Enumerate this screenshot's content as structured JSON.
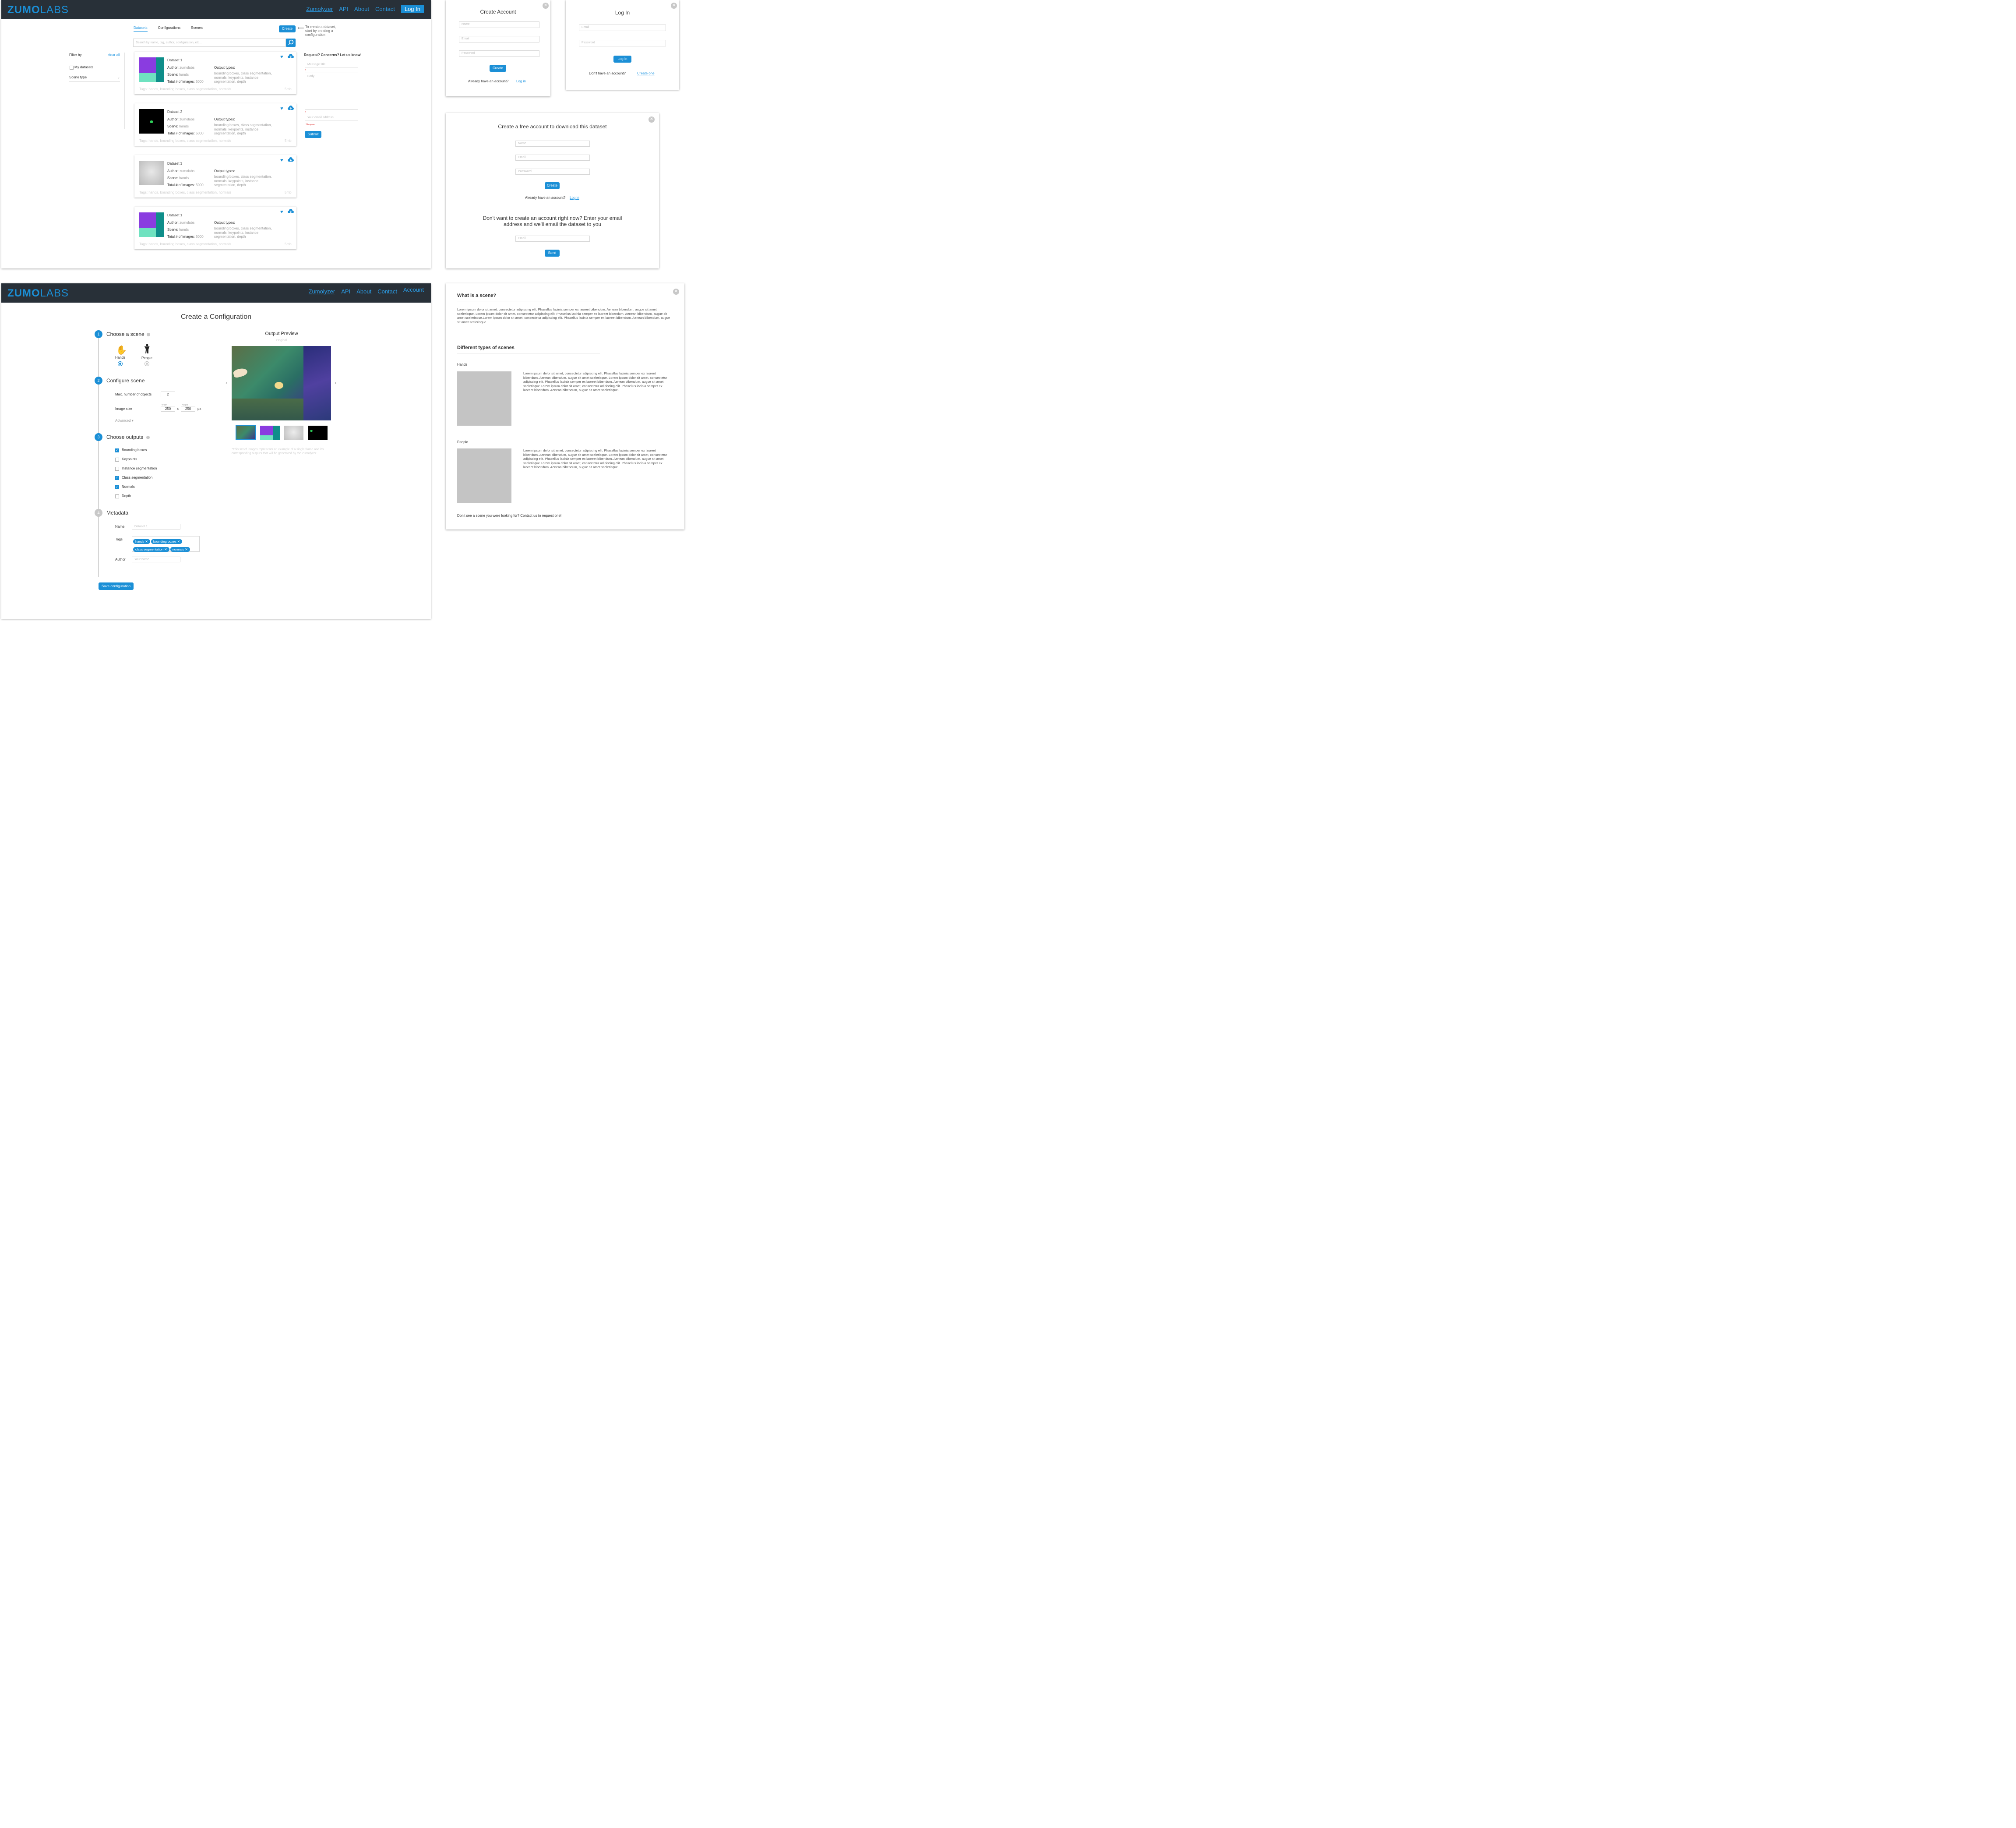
{
  "nav": {
    "logo_a": "ZUMO",
    "logo_b": "LABS",
    "links": [
      "Zumolyzer",
      "API",
      "About",
      "Contact"
    ],
    "login": "Log In",
    "account": "Account"
  },
  "datasets_page": {
    "tabs": [
      "Datasets",
      "Configurations",
      "Scenes"
    ],
    "create": "Create",
    "create_hint": "To create a dataset, start by creating a configuration",
    "search_placeholder": "Search by name, tag, author, configuration, etc...",
    "filter_by": "Filter by",
    "clear_all": "clear all",
    "my_datasets": "My datasets",
    "scene_type": "Scene type",
    "author_label": "Author:",
    "scene_label": "Scene:",
    "total_label": "Total # of images:",
    "output_label": "Output types:",
    "cards": [
      {
        "name": "Dataset 1",
        "author": "zumolabs",
        "scene": "hands",
        "total": "5000",
        "outputs": "bounding boxes, class segmentation, normals, keypoints, instance segmentation, depth",
        "tags": "Tags: hands, bounding boxes, class segmentation, normals",
        "size": "5mb"
      },
      {
        "name": "Dataset 2",
        "author": "zumolabs",
        "scene": "hands",
        "total": "5000",
        "outputs": "bounding boxes, class segmentation, normals, keypoints, instance segmentation, depth",
        "tags": "Tags: hands, bounding boxes, class segmentation, normals",
        "size": "5mb"
      },
      {
        "name": "Dataset 3",
        "author": "zumolabs",
        "scene": "hands",
        "total": "5000",
        "outputs": "bounding boxes, class segmentation, normals, keypoints, instance segmentation, depth",
        "tags": "Tags: hands, bounding boxes, class segmentation, normals",
        "size": "5mb"
      },
      {
        "name": "Dataset 1",
        "author": "zumolabs",
        "scene": "hands",
        "total": "5000",
        "outputs": "bounding boxes, class segmentation, normals, keypoints, instance segmentation, depth",
        "tags": "Tags: hands, bounding boxes, class segmentation, normals",
        "size": "5mb"
      }
    ],
    "request_title": "Request? Concerns? Let us know!",
    "message_title": "Message title",
    "body": "Body",
    "your_email": "Your email address",
    "required": "*Required",
    "submit": "Submit"
  },
  "create_account": {
    "title": "Create Account",
    "name": "Name",
    "email": "Email",
    "password": "Password",
    "button": "Create",
    "already": "Already have an account?",
    "login_link": "Log in"
  },
  "login_modal": {
    "title": "Log In",
    "email": "Email",
    "password": "Password",
    "button": "Log In",
    "no_account": "Don't have an account?",
    "create_link": "Create one"
  },
  "free_account": {
    "title": "Create a free account to download this dataset",
    "name": "Name",
    "email": "Email",
    "password": "Password",
    "button": "Create",
    "already": "Already have an account?",
    "login_link": "Log in",
    "alt_title": "Don't want to create an account right now? Enter your email address and we'll email the dataset to you",
    "alt_email": "Email",
    "send": "Send"
  },
  "config_page": {
    "title": "Create a Configuration",
    "step1": "Choose a scene",
    "hands": "Hands",
    "people": "People",
    "step2": "Configure scene",
    "max_objects": "Max. number of objects",
    "max_objects_val": "2",
    "image_size": "Image size",
    "width_label": "Width",
    "height_label": "Height",
    "width": "250",
    "height": "250",
    "x": "x",
    "px": "px",
    "advanced": "Advanced ▾",
    "step3": "Choose outputs",
    "outputs": [
      {
        "label": "Bounding boxes",
        "checked": true
      },
      {
        "label": "Keypoints",
        "checked": false
      },
      {
        "label": "Instance segmentation",
        "checked": false
      },
      {
        "label": "Class segmentation",
        "checked": true
      },
      {
        "label": "Normals",
        "checked": true
      },
      {
        "label": "Depth",
        "checked": false
      }
    ],
    "step4": "Metadata",
    "name_label": "Name",
    "name_placeholder": "Dataset 1",
    "tags_label": "Tags",
    "tags": [
      "hands",
      "bounding boxes",
      "class segmentation",
      "normals"
    ],
    "author_label": "Author",
    "author_placeholder": "Your name",
    "save": "Save configuration",
    "preview_title": "Output Preview",
    "preview_sub": "Original",
    "preview_note": "*This set of images represents an example of a single frame and it's corresponding outputs that will be generated by the Zumolyzer"
  },
  "scene_info": {
    "q": "What is a scene?",
    "lorem1": "Lorem ipsum dolor sit amet, consectetur adipiscing elit. Phasellus lacinia semper ex laoreet bibendum. Aenean bibendum, augue sit amet scelerisque. Lorem ipsum dolor sit amet, consectetur adipiscing elit. Phasellus lacinia semper ex laoreet bibendum. Aenean bibendum, augue sit amet scelerisque.Lorem ipsum dolor sit amet, consectetur adipiscing elit. Phasellus lacinia semper ex laoreet bibendum. Aenean bibendum, augue sit amet scelerisque.",
    "types": "Different types of scenes",
    "hands": "Hands",
    "people": "People",
    "lorem2": "Lorem ipsum dolor sit amet, consectetur adipiscing elit. Phasellus lacinia semper ex laoreet bibendum. Aenean bibendum, augue sit amet scelerisque. Lorem ipsum dolor sit amet, consectetur adipiscing elit. Phasellus lacinia semper ex laoreet bibendum. Aenean bibendum, augue sit amet scelerisque.Lorem ipsum dolor sit amet, consectetur adipiscing elit. Phasellus lacinia semper ex laoreet bibendum. Aenean bibendum, augue sit amet scelerisque.",
    "footer": "Don't see a scene you were looking for? Contact us to request one!"
  }
}
